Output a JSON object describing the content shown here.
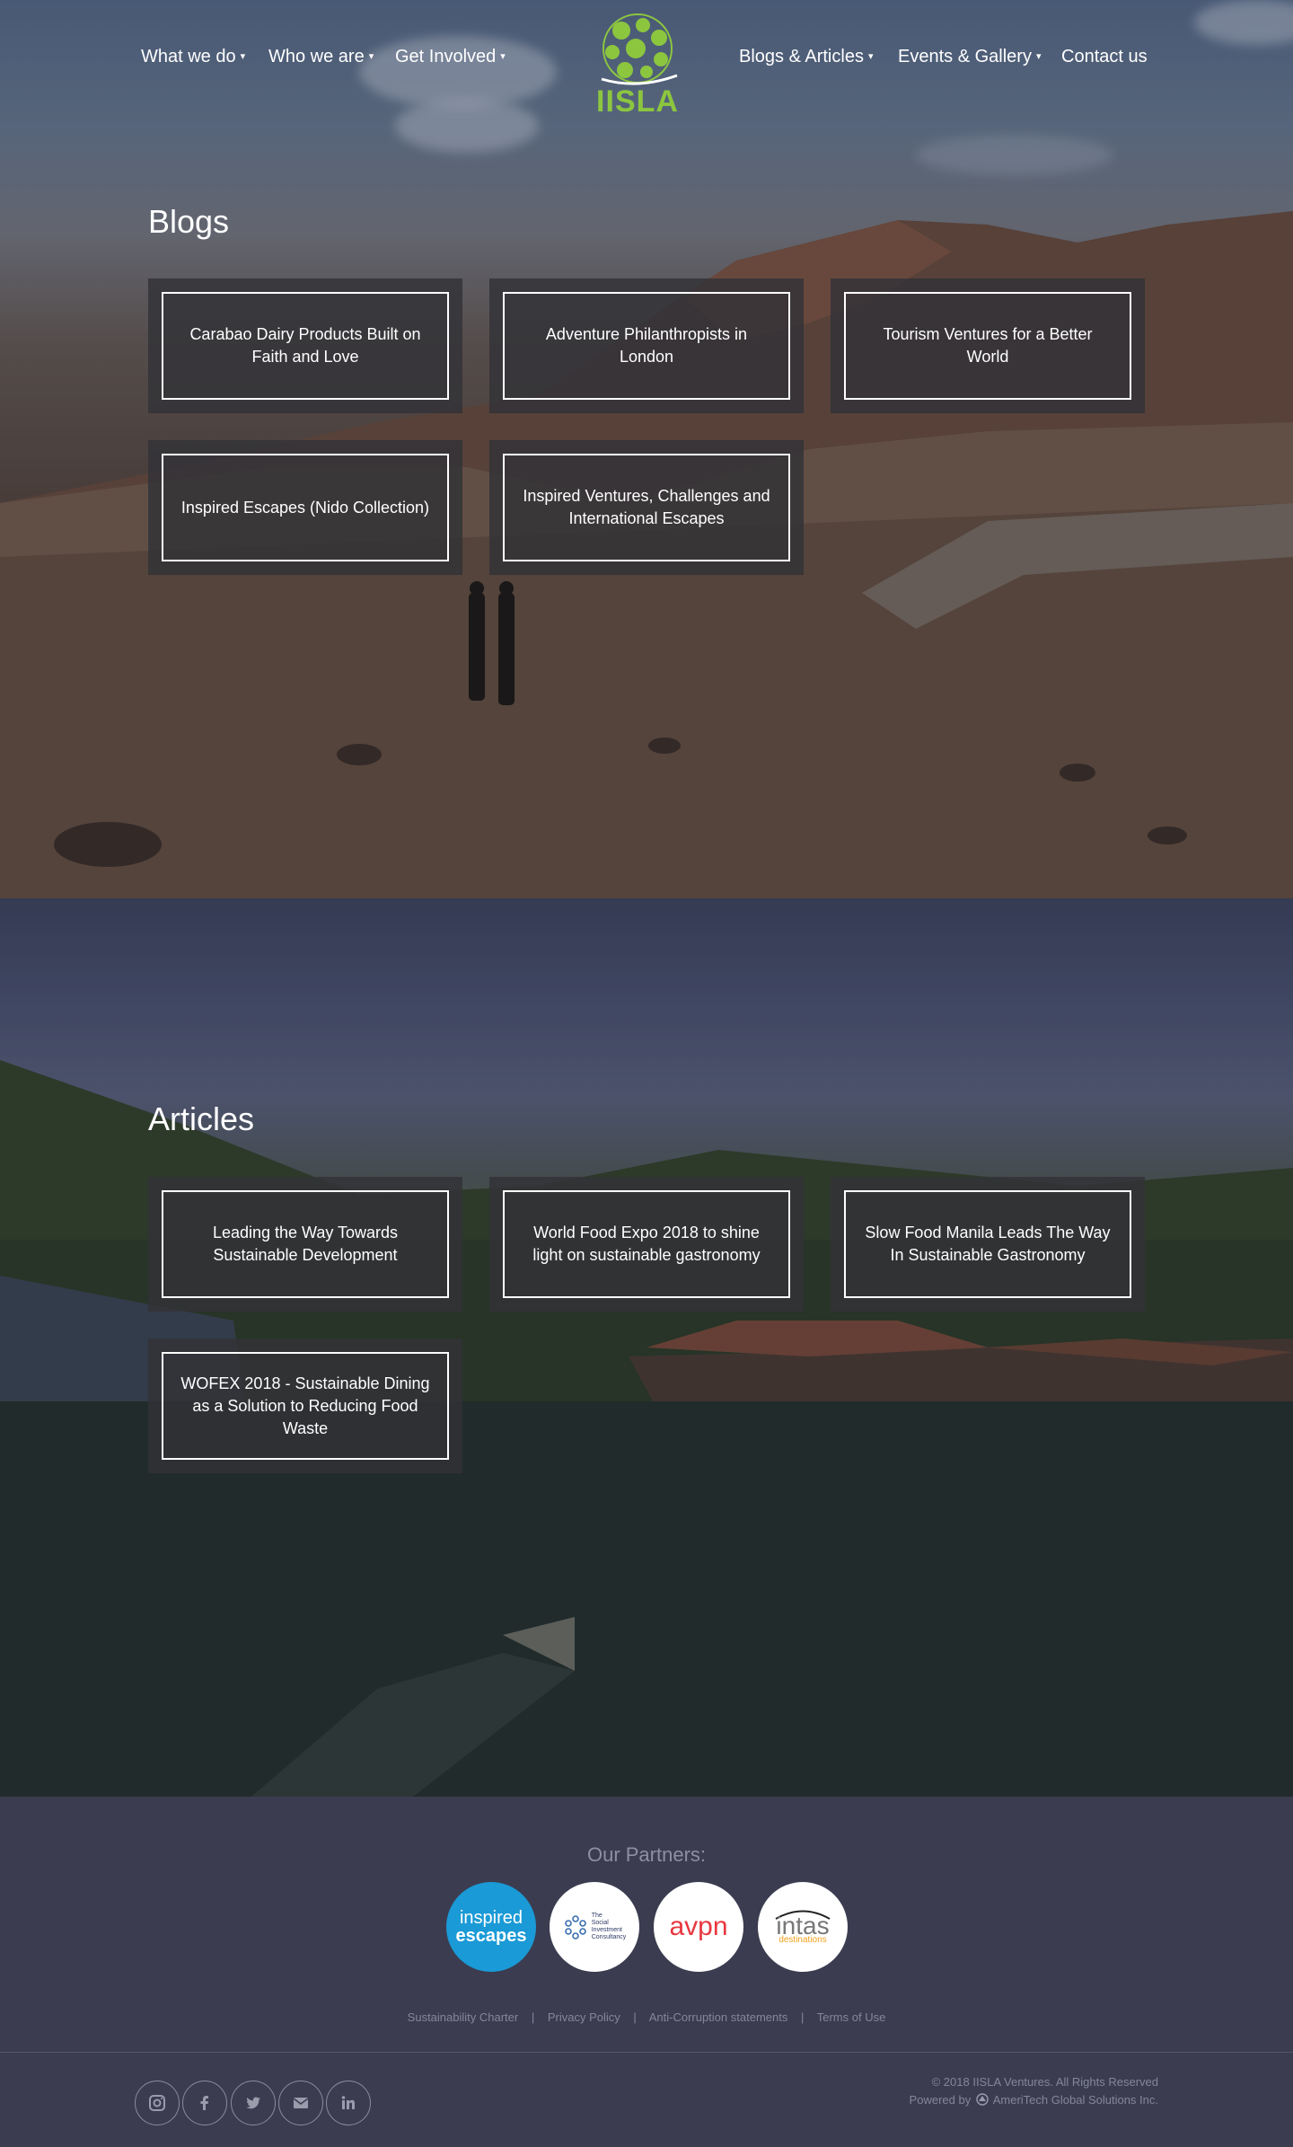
{
  "nav": {
    "left": [
      {
        "label": "What we do"
      },
      {
        "label": "Who we are"
      },
      {
        "label": "Get Involved"
      }
    ],
    "right": [
      {
        "label": "Blogs & Articles"
      },
      {
        "label": "Events & Gallery"
      },
      {
        "label": "Contact us"
      }
    ],
    "caret": "▾",
    "logo_text": "IISLA"
  },
  "blogs": {
    "title": "Blogs",
    "items": [
      {
        "label": "Carabao Dairy Products Built on Faith and Love"
      },
      {
        "label": "Adventure Philanthropists in London"
      },
      {
        "label": "Tourism Ventures for a Better World"
      },
      {
        "label": "Inspired Escapes (Nido Collection)"
      },
      {
        "label": "Inspired Ventures, Challenges and International Escapes"
      }
    ]
  },
  "articles": {
    "title": "Articles",
    "items": [
      {
        "label": "Leading the Way Towards Sustainable Development"
      },
      {
        "label": "World Food Expo 2018 to shine light on sustainable gastronomy"
      },
      {
        "label": "Slow Food Manila Leads The Way In Sustainable Gastronomy"
      },
      {
        "label": "WOFEX 2018 - Sustainable Dining as a Solution to Reducing Food Waste"
      }
    ]
  },
  "footer": {
    "partners_title": "Our Partners:",
    "partners": [
      {
        "name": "inspired escapes",
        "line1": "inspired",
        "line2": "escapes"
      },
      {
        "name": "The Social Investment Consultancy",
        "line1": "The",
        "line2": "Social",
        "line3": "Investment",
        "line4": "Consultancy"
      },
      {
        "name": "avpn",
        "line1": "avpn"
      },
      {
        "name": "intas destinations",
        "line1": "intas",
        "line2": "destinations"
      }
    ],
    "links": [
      {
        "label": "Sustainability Charter"
      },
      {
        "label": "Privacy Policy"
      },
      {
        "label": "Anti-Corruption statements"
      },
      {
        "label": "Terms of Use"
      }
    ],
    "link_separator": "|",
    "social": [
      {
        "icon": "instagram-icon"
      },
      {
        "icon": "facebook-icon"
      },
      {
        "icon": "twitter-icon"
      },
      {
        "icon": "email-icon"
      },
      {
        "icon": "linkedin-icon"
      }
    ],
    "copyright": "© 2018 IISLA Ventures. All Rights Reserved",
    "powered_prefix": "Powered by",
    "powered_by": "AmeriTech Global Solutions Inc."
  },
  "colors": {
    "logo_green": "#8cc63f",
    "footer_bg": "#3b3c50",
    "card_bg": "#323237",
    "inspired_blue": "#1a9ad6",
    "avpn_red": "#e8373e",
    "intas_orange": "#f0a21b"
  }
}
